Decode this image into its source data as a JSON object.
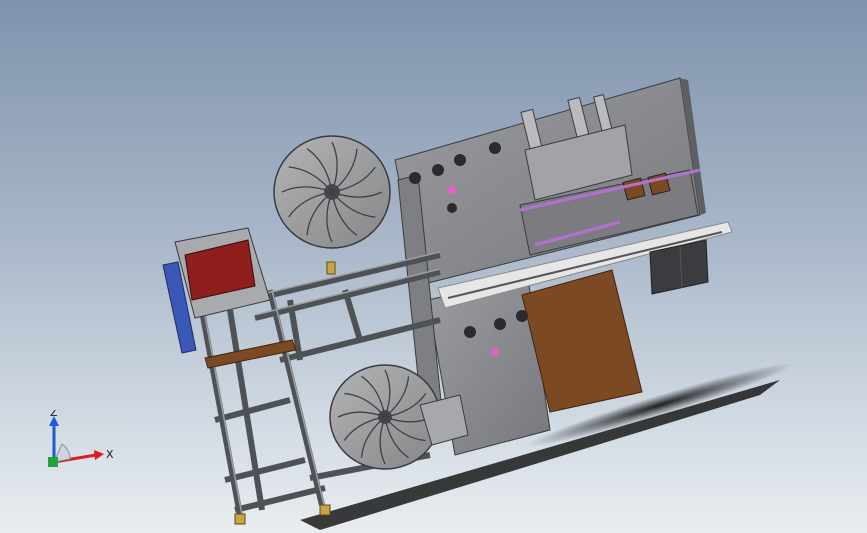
{
  "viewport": {
    "background_top": "#7f93ad",
    "background_bottom": "#e9edf1"
  },
  "model": {
    "frame_color": "#5a5d62",
    "plate_color": "#8d8f93",
    "reel_color": "#9a9b9e",
    "screen_color": "#8f1e1e",
    "wood_color": "#7b4a22",
    "base_color": "#c8c8c8",
    "accent_pink": "#e860c8",
    "accent_blue": "#3b58b6",
    "rail_color": "#6b6e73"
  },
  "triad": {
    "z_label": "Z",
    "x_label": "X",
    "z_color": "#1d5ad6",
    "x_color": "#d81f1f",
    "y_color": "#1fa33a"
  }
}
